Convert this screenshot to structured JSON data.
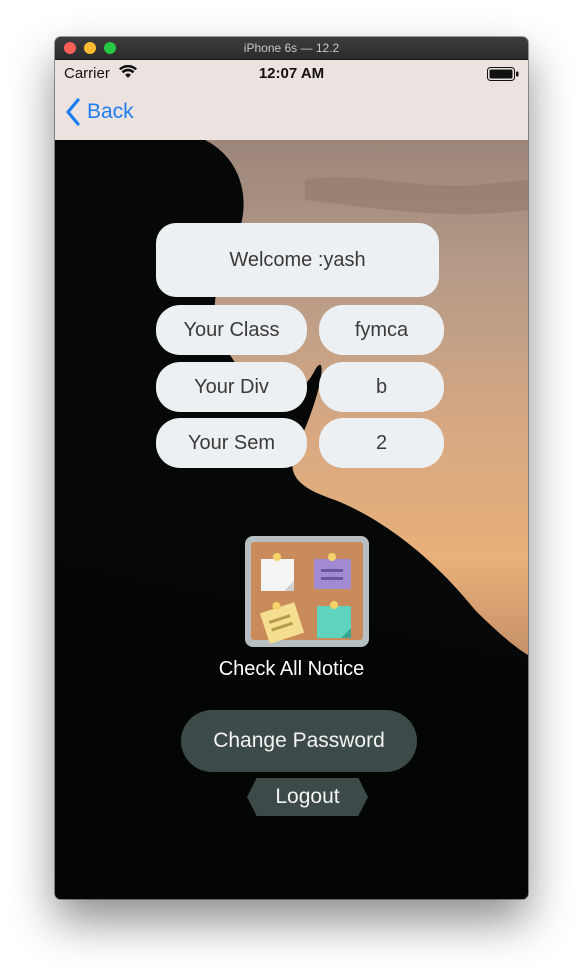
{
  "window": {
    "title": "iPhone 6s — 12.2"
  },
  "status_bar": {
    "carrier": "Carrier",
    "time": "12:07 AM"
  },
  "nav": {
    "back_label": "Back"
  },
  "profile": {
    "welcome": "Welcome :yash",
    "rows": [
      {
        "label": "Your Class",
        "value": "fymca"
      },
      {
        "label": "Your Div",
        "value": "b"
      },
      {
        "label": "Your Sem",
        "value": "2"
      }
    ]
  },
  "actions": {
    "notice_label": "Check All Notice",
    "notice_icon": "notice-board-icon",
    "change_password": "Change Password",
    "logout": "Logout"
  },
  "colors": {
    "accent": "#1e7cf3",
    "nav_background": "#ece3e0",
    "pill_background": "#edf0f3",
    "button_background": "#3d4a4a"
  }
}
